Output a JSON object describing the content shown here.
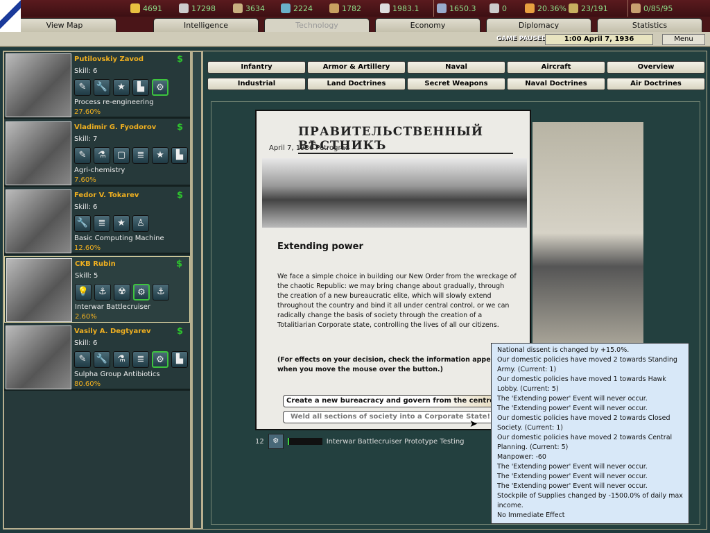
{
  "resources": [
    {
      "name": "energy",
      "value": "4691",
      "color": "#e8c040"
    },
    {
      "name": "metal",
      "value": "17298",
      "color": "#ccc"
    },
    {
      "name": "rare-materials",
      "value": "3634",
      "color": "#c8b080"
    },
    {
      "name": "oil",
      "value": "2224",
      "color": "#6ab0c8"
    },
    {
      "name": "supplies",
      "value": "1782",
      "color": "#c8a060"
    },
    {
      "name": "money",
      "value": "1983.1",
      "color": "#ddd"
    },
    {
      "name": "manpower",
      "value": "1650.3",
      "color": "#9ac"
    },
    {
      "name": "transports",
      "value": "0",
      "color": "#ccc"
    },
    {
      "name": "dissent",
      "value": "20.36%",
      "color": "#e8a040"
    },
    {
      "name": "convoys",
      "value": "23/191",
      "color": "#c8b060"
    },
    {
      "name": "ic",
      "value": "0/85/95",
      "color": "#c8a070"
    }
  ],
  "tabs": [
    "View Map",
    "Intelligence",
    "Technology",
    "Economy",
    "Diplomacy",
    "Statistics"
  ],
  "status": {
    "paused": "GAME PAUSED",
    "date": "1:00 April 7, 1936",
    "menu": "Menu"
  },
  "teams": [
    {
      "name": "Putilovskiy Zavod",
      "skill": "Skill: 6",
      "icons": [
        "✎",
        "🔧",
        "★",
        "▙",
        "⚙"
      ],
      "project": "Process re-engineering",
      "pct": "27.60%"
    },
    {
      "name": "Vladimir G. Fyodorov",
      "skill": "Skill: 7",
      "icons": [
        "✎",
        "⚗",
        "▢",
        "≣",
        "★",
        "▙"
      ],
      "project": "Agri-chemistry",
      "pct": "7.60%"
    },
    {
      "name": "Fedor V. Tokarev",
      "skill": "Skill: 6",
      "icons": [
        "🔧",
        "≣",
        "★",
        "♙"
      ],
      "project": "Basic Computing Machine",
      "pct": "12.60%"
    },
    {
      "name": "CKB Rubin",
      "skill": "Skill: 5",
      "icons": [
        "💡",
        "⚓",
        "☢",
        "⚙",
        "⚓"
      ],
      "project": "Interwar Battlecruiser",
      "pct": "2.60%"
    },
    {
      "name": "Vasily A. Degtyarev",
      "skill": "Skill: 6",
      "icons": [
        "✎",
        "🔧",
        "⚗",
        "≣",
        "⚙",
        "▙"
      ],
      "project": "Sulpha Group Antibiotics",
      "pct": "80.60%"
    }
  ],
  "categories": [
    "Infantry",
    "Armor & Artillery",
    "Naval",
    "Aircraft",
    "Overview",
    "Industrial",
    "Land Doctrines",
    "Secret Weapons",
    "Naval Doctrines",
    "Air Doctrines"
  ],
  "event": {
    "newspaper": "ПРАВИТЕЛЬСТВЕННЫЙ ВѢСТНИКЪ",
    "dateline": "April 7, 1936 Petrograd",
    "title": "Extending power",
    "text": "We face a simple choice in building our New Order from the wreckage of the chaotic Republic: we may bring change about gradually, through the creation of a new bureaucratic elite, which will slowly extend throughout the country and bind it all under central control, or we can radically change the basis of society through the creation of a Totalitiarian Corporate state, controlling the lives of all our citizens.",
    "note": "(For effects on your decision, check the information appearing when you move the mouse over the button.)",
    "choice1": "Create a new bureacracy and govern from the centre",
    "choice2": "Weld all sections of society into a Corporate State!"
  },
  "progress": {
    "days": "12",
    "label": "Interwar Battlecruiser Prototype Testing",
    "fraction": 0.04
  },
  "tooltip": [
    "National dissent is changed by +15.0%.",
    "Our domestic policies have moved 2 towards Standing Army. (Current: 1)",
    "Our domestic policies have moved 1 towards Hawk Lobby. (Current: 5)",
    "The 'Extending power' Event will never occur.",
    "The 'Extending power' Event will never occur.",
    "Our domestic policies have moved 2 towards Closed Society. (Current: 1)",
    "Our domestic policies have moved 2 towards Central Planning. (Current: 5)",
    "Manpower: -60",
    "The 'Extending power' Event will never occur.",
    "The 'Extending power' Event will never occur.",
    "The 'Extending power' Event will never occur.",
    "Stockpile of Supplies changed by -1500.0% of daily max income.",
    "No Immediate Effect"
  ]
}
